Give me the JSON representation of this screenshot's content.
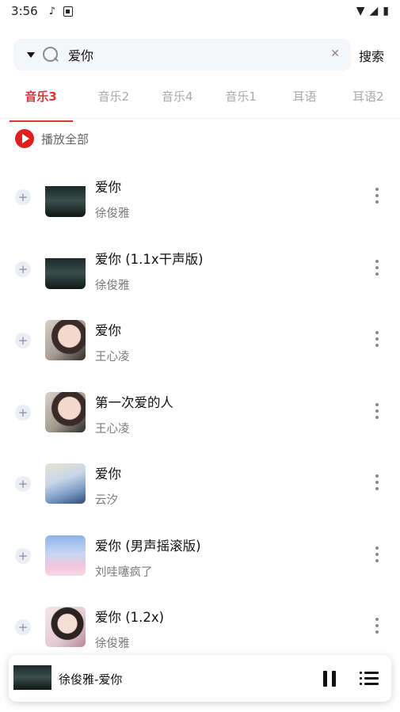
{
  "status_bar": {
    "time": "3:56",
    "icons": [
      "music-note-icon",
      "text-a-icon",
      "wifi-icon",
      "signal-icon",
      "battery-icon"
    ]
  },
  "search": {
    "value": "爱你",
    "placeholder": "",
    "submit_label": "搜索"
  },
  "tabs": [
    {
      "label": "音乐3",
      "active": true
    },
    {
      "label": "音乐2",
      "active": false
    },
    {
      "label": "音乐4",
      "active": false
    },
    {
      "label": "音乐1",
      "active": false
    },
    {
      "label": "耳语",
      "active": false
    },
    {
      "label": "耳语2",
      "active": false
    }
  ],
  "play_all": {
    "label": "播放全部"
  },
  "songs": [
    {
      "title": "爱你",
      "artist": "徐俊雅"
    },
    {
      "title": "爱你 (1.1x干声版)",
      "artist": "徐俊雅"
    },
    {
      "title": "爱你",
      "artist": "王心凌"
    },
    {
      "title": "第一次爱的人",
      "artist": "王心凌"
    },
    {
      "title": "爱你",
      "artist": "云汐"
    },
    {
      "title": "爱你 (男声摇滚版)",
      "artist": "刘哇噻疯了"
    },
    {
      "title": "爱你 (1.2x)",
      "artist": "徐俊雅"
    }
  ],
  "now_playing": {
    "title": "徐俊雅-爱你"
  },
  "colors": {
    "accent": "#d9343a",
    "play_all": "#e02020"
  }
}
